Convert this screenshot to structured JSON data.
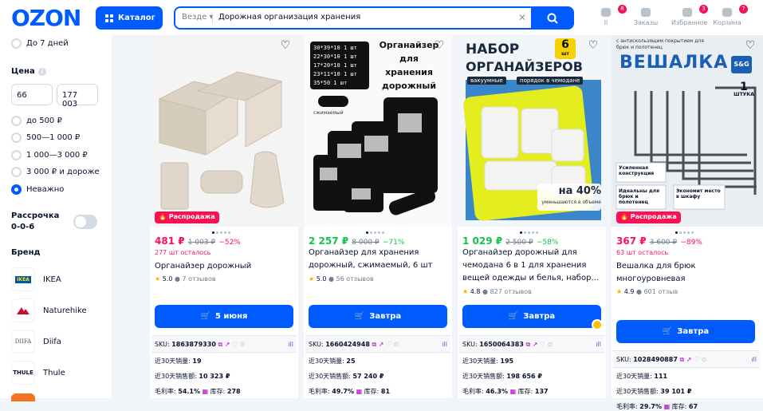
{
  "header": {
    "logo": "OZON",
    "catalog_label": "Каталог",
    "search": {
      "scope": "Везде",
      "query": "Дорожная организация хранения"
    },
    "icons": [
      {
        "name": "li",
        "label": "li",
        "badge": "8"
      },
      {
        "name": "orders",
        "label": "Заказы",
        "badge": ""
      },
      {
        "name": "favorites",
        "label": "Избранное",
        "badge": "3"
      },
      {
        "name": "cart",
        "label": "Корзина",
        "badge": "7"
      }
    ]
  },
  "sidebar": {
    "delivery_option": "До 7 дней",
    "price": {
      "title": "Цена",
      "from": "66",
      "to": "177 003",
      "options": [
        "до 500 ₽",
        "500—1 000 ₽",
        "1 000—3 000 ₽",
        "3 000 ₽ и дороже",
        "Неважно"
      ],
      "selected_index": 4
    },
    "installment": "Рассрочка 0-0-6",
    "brand_title": "Бренд",
    "brands": [
      "IKEA",
      "Naturehike",
      "Diifa",
      "Thule"
    ]
  },
  "products": [
    {
      "promo": "Распродажа",
      "price": "481 ₽",
      "old_price": "1 003 ₽",
      "discount": "−52%",
      "price_color": "#f91155",
      "stock_left": "277 шт осталось",
      "name": "Органайзер дорожный",
      "rating": "5.0",
      "reviews": "7 отзывов",
      "button": "5 июня",
      "sku_label": "SKU:",
      "sku": "1863879330",
      "stat1_label": "近30天销量:",
      "stat1_value": "19",
      "stat2_label": "近30天销售额:",
      "stat2_value": "10 323 ₽",
      "margin_label": "毛利率:",
      "margin_value": "54.1%",
      "stock_label": "库存:",
      "stock_value": "278"
    },
    {
      "promo": "",
      "price": "2 257 ₽",
      "old_price": "8 000 ₽",
      "discount": "−71%",
      "price_color": "#10c44c",
      "stock_left": "",
      "name": "Органайзер для хранения дорожный, сжимаемый, 6 шт",
      "rating": "5.0",
      "reviews": "56 отзывов",
      "button": "Завтра",
      "sku_label": "SKU:",
      "sku": "1660424948",
      "stat1_label": "近30天销量:",
      "stat1_value": "25",
      "stat2_label": "近30天销售额:",
      "stat2_value": "57 240 ₽",
      "margin_label": "毛利率:",
      "margin_value": "49.7%",
      "stock_label": "库存:",
      "stock_value": "81",
      "image_text": {
        "title": "Органайзер для хранения дорожный",
        "sizes": [
          "30*39*10",
          "22*30*10",
          "17*20*10",
          "23*11*10",
          "35*50"
        ],
        "qty": [
          "1 шт",
          "1 шт",
          "1 шт",
          "1 шт",
          "1 шт"
        ],
        "note": "сжимаемый"
      }
    },
    {
      "promo": "",
      "price": "1 029 ₽",
      "old_price": "2 500 ₽",
      "discount": "−58%",
      "price_color": "#10c44c",
      "stock_left": "",
      "name": "Органайзер дорожный для чемодана 6 в 1 для хранения вещей одежды и белья, набор...",
      "rating": "4.8",
      "reviews": "827 отзывов",
      "button": "Завтра",
      "sku_label": "SKU:",
      "sku": "1650064383",
      "stat1_label": "近30天销量:",
      "stat1_value": "195",
      "stat2_label": "近30天销售额:",
      "stat2_value": "198 656 ₽",
      "margin_label": "毛利率:",
      "margin_value": "46.3%",
      "stock_label": "库存:",
      "stock_value": "137",
      "image_text": {
        "title1": "НАБОР",
        "badge_num": "6",
        "badge_unit": "шт",
        "title2": "ОРГАНАЙЗЕРОВ",
        "tag1": "вакуумные",
        "tag2": "порядок в чемодане",
        "percent": "на 40%",
        "percent_note": "уменьшаются в объеме"
      }
    },
    {
      "promo": "Распродажа",
      "price": "367 ₽",
      "old_price": "3 600 ₽",
      "discount": "−89%",
      "price_color": "#f91155",
      "stock_left": "63 шт осталось",
      "name": "Вешалка для брюк многоуровневая",
      "rating": "4.9",
      "reviews": "601 отзыв",
      "button": "Завтра",
      "sku_label": "SKU:",
      "sku": "1028490887",
      "stat1_label": "近30天销量:",
      "stat1_value": "111",
      "stat2_label": "近30天销售额:",
      "stat2_value": "39 101 ₽",
      "margin_label": "毛利率:",
      "margin_value": "29.7%",
      "stock_label": "库存:",
      "stock_value": "67",
      "image_text": {
        "top": "с антискользящим покрытием для брюк и полотенец",
        "title": "ВЕШАЛКА",
        "brand": "S&G",
        "qty_num": "1",
        "qty_unit": "ШТУКА",
        "f1": "Усиленная конструкция",
        "f2": "Идеальны для брюк и полотенец",
        "f3": "Экономит место в шкафу"
      }
    }
  ]
}
